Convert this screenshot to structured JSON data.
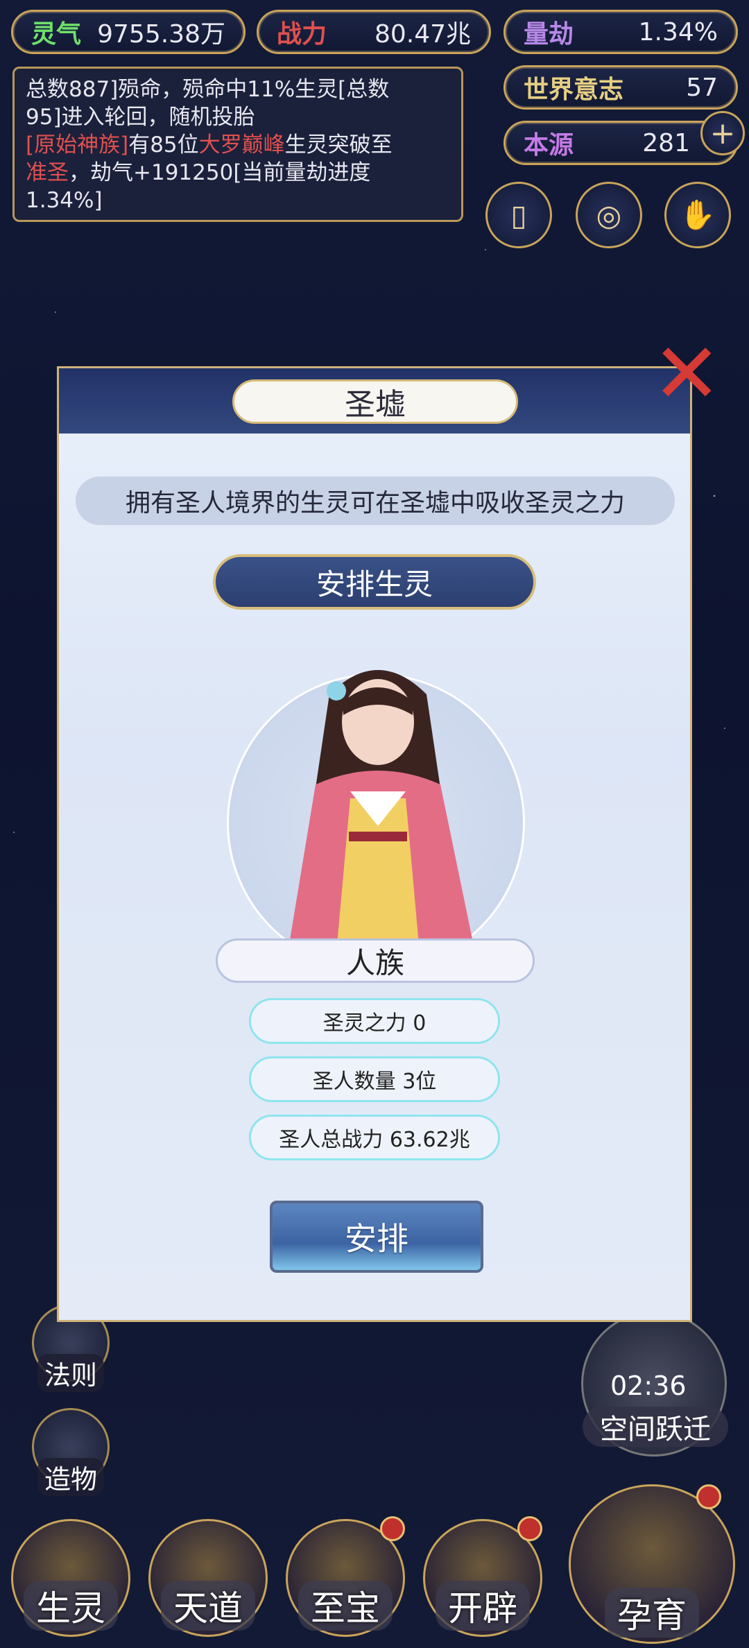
{
  "stats": {
    "lingqi_label": "灵气",
    "lingqi_value": "9755.38万",
    "zhanli_label": "战力",
    "zhanli_value": "80.47兆",
    "liangjie_label": "量劫",
    "liangjie_value": "1.34%",
    "shijie_label": "世界意志",
    "shijie_value": "57",
    "benyuan_label": "本源",
    "benyuan_value": "281"
  },
  "log": {
    "line1": "总数887]殒命，殒命中11%生灵[总数",
    "line2": "95]进入轮回，随机投胎",
    "line3a": "[原始神族]",
    "line3b": "有85位",
    "line3c": "大罗巅峰",
    "line3d": "生灵突破至",
    "line4a": "准圣",
    "line4b": "，劫气+191250[当前量劫进度",
    "line5": "1.34%]"
  },
  "modal": {
    "title": "圣墟",
    "description": "拥有圣人境界的生灵可在圣墟中吸收圣灵之力",
    "arrange_banner": "安排生灵",
    "race": "人族",
    "stat1": "圣灵之力 0",
    "stat2": "圣人数量 3位",
    "stat3": "圣人总战力 63.62兆",
    "arrange_button": "安排"
  },
  "side_left": [
    "法则",
    "造物"
  ],
  "timer": {
    "time": "02:36",
    "label": "空间跃迁"
  },
  "bottom_nav": [
    "生灵",
    "天道",
    "至宝",
    "开辟",
    "孕育"
  ],
  "colors": {
    "accent_gold": "#c9a45a",
    "close_red": "#d63a34",
    "banner_blue": "#2c3f70"
  }
}
